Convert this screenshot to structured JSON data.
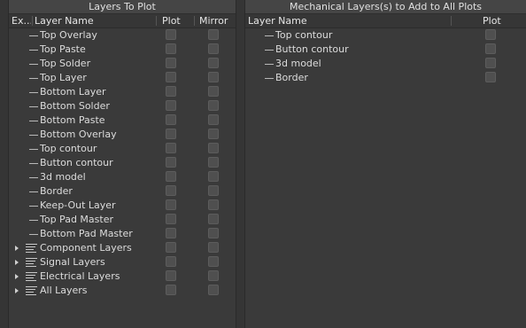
{
  "left": {
    "title": "Layers To Plot",
    "columns": {
      "expand": "Ex...",
      "name": "Layer Name",
      "plot": "Plot",
      "mirror": "Mirror"
    },
    "rows": [
      {
        "name": "Top Overlay",
        "kind": "leaf"
      },
      {
        "name": "Top Paste",
        "kind": "leaf"
      },
      {
        "name": "Top Solder",
        "kind": "leaf"
      },
      {
        "name": "Top Layer",
        "kind": "leaf"
      },
      {
        "name": "Bottom Layer",
        "kind": "leaf"
      },
      {
        "name": "Bottom Solder",
        "kind": "leaf"
      },
      {
        "name": "Bottom Paste",
        "kind": "leaf"
      },
      {
        "name": "Bottom Overlay",
        "kind": "leaf"
      },
      {
        "name": "Top contour",
        "kind": "leaf"
      },
      {
        "name": "Button contour",
        "kind": "leaf"
      },
      {
        "name": "3d model",
        "kind": "leaf"
      },
      {
        "name": "Border",
        "kind": "leaf"
      },
      {
        "name": "Keep-Out Layer",
        "kind": "leaf"
      },
      {
        "name": "Top Pad Master",
        "kind": "leaf"
      },
      {
        "name": "Bottom Pad Master",
        "kind": "leaf"
      },
      {
        "name": "Component Layers",
        "kind": "group"
      },
      {
        "name": "Signal Layers",
        "kind": "group"
      },
      {
        "name": "Electrical Layers",
        "kind": "group"
      },
      {
        "name": "All Layers",
        "kind": "group"
      }
    ]
  },
  "right": {
    "title": "Mechanical Layers(s) to Add to All Plots",
    "columns": {
      "name": "Layer Name",
      "plot": "Plot"
    },
    "rows": [
      {
        "name": "Top contour"
      },
      {
        "name": "Button contour"
      },
      {
        "name": "3d model"
      },
      {
        "name": "Border"
      }
    ]
  }
}
